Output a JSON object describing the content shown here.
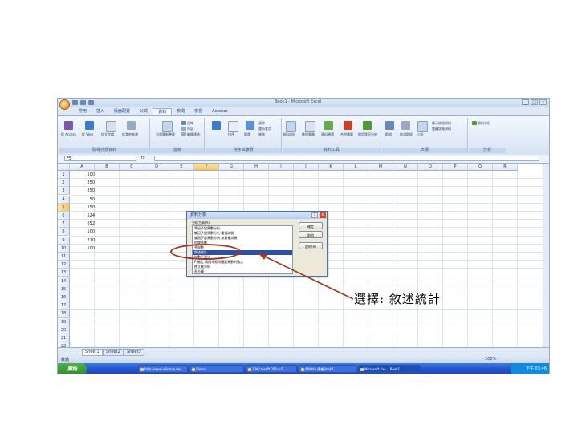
{
  "window": {
    "title": "Book1 - Microsoft Excel",
    "controls": [
      "_",
      "□",
      "x"
    ]
  },
  "ribbon": {
    "tabs": [
      "常用",
      "插入",
      "版面配置",
      "公式",
      "資料",
      "校閱",
      "檢視",
      "Acrobat"
    ],
    "active_tab": "資料",
    "groups": [
      "取得外部資料",
      "連線",
      "排序與篩選",
      "資料工具",
      "大綱",
      "分析"
    ],
    "items": {
      "from_access": "從 Access",
      "from_web": "從 Web",
      "from_text": "從文字檔",
      "other_sources": "從其他來源",
      "existing": "現有連線",
      "refresh_all": "全部重新整理",
      "connections": "連線",
      "properties": "內容",
      "edit_links": "編輯連結",
      "sort": "排序",
      "filter": "篩選",
      "clear": "清除",
      "reapply": "重新套用",
      "advanced": "進階",
      "text_to_columns": "資料剖析",
      "remove_duplicates": "移除重複",
      "data_validation": "資料驗證",
      "consolidate": "合併彙算",
      "what_if": "假設狀況分析",
      "group": "群組",
      "ungroup": "取消群組",
      "subtotal": "小計",
      "show_detail": "顯示詳細資料",
      "hide_detail": "隱藏詳細資料",
      "data_analysis": "資料分析"
    }
  },
  "formula_bar": {
    "name_box": "F5",
    "fx": "fx",
    "formula": ""
  },
  "sheet": {
    "columns": [
      "A",
      "B",
      "C",
      "D",
      "E",
      "F",
      "G",
      "H",
      "I",
      "J",
      "K",
      "L",
      "M",
      "N",
      "O",
      "P",
      "Q",
      "R"
    ],
    "rows": [
      "1",
      "2",
      "3",
      "4",
      "5",
      "6",
      "7",
      "8",
      "9",
      "10",
      "11",
      "12",
      "13",
      "14",
      "15",
      "16",
      "17",
      "18",
      "19",
      "20",
      "21",
      "22"
    ],
    "column_a_values": [
      "100",
      "250",
      "850",
      "50",
      "150",
      "524",
      "652",
      "100",
      "210",
      "100"
    ]
  },
  "sheet_tabs": [
    "Sheet1",
    "Sheet2",
    "Sheet3"
  ],
  "status": {
    "ready": "就緒",
    "zoom": "100%"
  },
  "dialog": {
    "title": "資料分析",
    "list_label": "分析工具(A)",
    "items": [
      "單因子變異數分析",
      "雙因子變異數分析:重複試驗",
      "雙因子變異數分析:無重複試驗",
      "相關係數",
      "共變數",
      "敘述統計",
      "指數平滑法",
      "F-檢定:兩個常態母體變異數的檢定",
      "傅立葉分析",
      "直方圖"
    ],
    "selected_index": 5,
    "buttons": [
      "確定",
      "取消",
      "說明(H)"
    ]
  },
  "taskbar": {
    "start": "開始",
    "items": [
      "http://www.wikihoo.tw/...",
      "Slides",
      "3 Microsoft Office P...",
      "ANOVA 講義Book1...",
      "Microsoft Exc... Book1"
    ],
    "clock": "下午 03:46"
  },
  "annotation": {
    "caption": "選擇: 敘述統計"
  }
}
